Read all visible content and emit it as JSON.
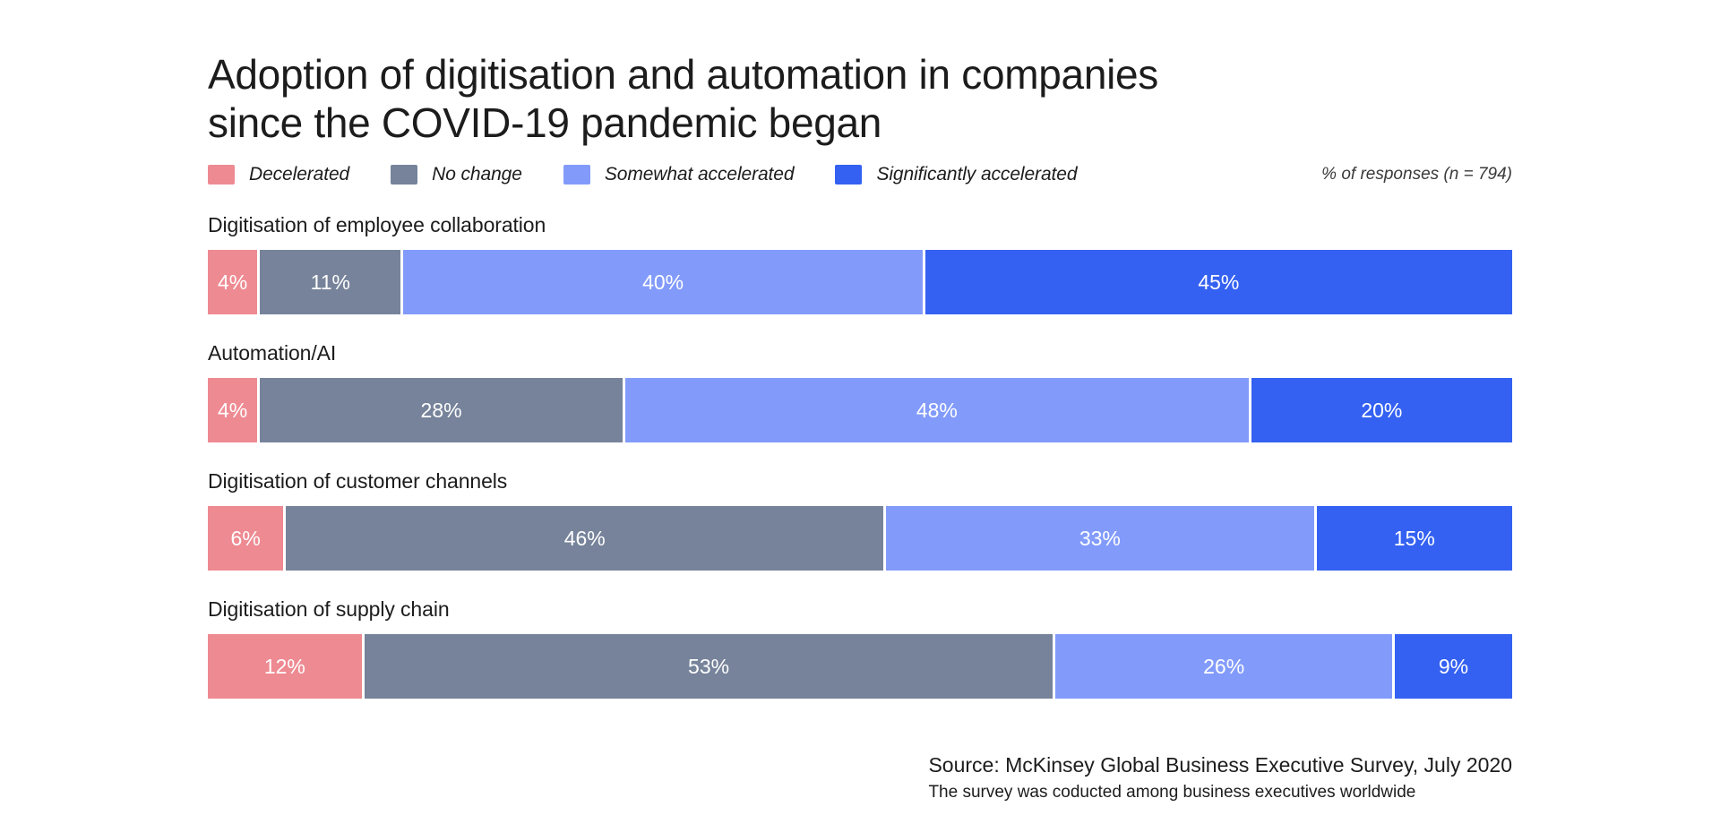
{
  "title": "Adoption of digitisation and automation in companies\nsince the COVID-19 pandemic began",
  "legend": {
    "note": "% of responses (n = 794)",
    "items": [
      {
        "label": "Decelerated",
        "color": "#ee8a92"
      },
      {
        "label": "No change",
        "color": "#76839a"
      },
      {
        "label": "Somewhat accelerated",
        "color": "#829bfb"
      },
      {
        "label": "Significantly accelerated",
        "color": "#3461f2"
      }
    ]
  },
  "footer": {
    "source": "Source: McKinsey Global Business Executive Survey, July 2020",
    "note": "The survey was coducted among business executives worldwide"
  },
  "chart_data": {
    "type": "bar",
    "subtype": "stacked-horizontal-100",
    "title": "Adoption of digitisation and automation in companies since the COVID-19 pandemic began",
    "xlabel": "",
    "ylabel": "",
    "xlim": [
      0,
      100
    ],
    "grid": false,
    "legend_position": "top-left",
    "value_suffix": "%",
    "categories": [
      "Digitisation of employee collaboration",
      "Automation/AI",
      "Digitisation of customer channels",
      "Digitisation of supply chain"
    ],
    "series": [
      {
        "name": "Decelerated",
        "color": "#ee8a92",
        "values": [
          4,
          4,
          6,
          12
        ]
      },
      {
        "name": "No change",
        "color": "#76839a",
        "values": [
          11,
          28,
          46,
          53
        ]
      },
      {
        "name": "Somewhat accelerated",
        "color": "#829bfb",
        "values": [
          40,
          48,
          33,
          26
        ]
      },
      {
        "name": "Significantly accelerated",
        "color": "#3461f2",
        "values": [
          45,
          20,
          15,
          9
        ]
      }
    ],
    "bars": [
      {
        "label": "Digitisation of employee collaboration",
        "segments": [
          {
            "name": "Decelerated",
            "value": 4,
            "text": "4%",
            "color": "#ee8a92"
          },
          {
            "name": "No change",
            "value": 11,
            "text": "11%",
            "color": "#76839a"
          },
          {
            "name": "Somewhat accelerated",
            "value": 40,
            "text": "40%",
            "color": "#829bfb"
          },
          {
            "name": "Significantly accelerated",
            "value": 45,
            "text": "45%",
            "color": "#3461f2"
          }
        ]
      },
      {
        "label": "Automation/AI",
        "segments": [
          {
            "name": "Decelerated",
            "value": 4,
            "text": "4%",
            "color": "#ee8a92"
          },
          {
            "name": "No change",
            "value": 28,
            "text": "28%",
            "color": "#76839a"
          },
          {
            "name": "Somewhat accelerated",
            "value": 48,
            "text": "48%",
            "color": "#829bfb"
          },
          {
            "name": "Significantly accelerated",
            "value": 20,
            "text": "20%",
            "color": "#3461f2"
          }
        ]
      },
      {
        "label": "Digitisation of customer channels",
        "segments": [
          {
            "name": "Decelerated",
            "value": 6,
            "text": "6%",
            "color": "#ee8a92"
          },
          {
            "name": "No change",
            "value": 46,
            "text": "46%",
            "color": "#76839a"
          },
          {
            "name": "Somewhat accelerated",
            "value": 33,
            "text": "33%",
            "color": "#829bfb"
          },
          {
            "name": "Significantly accelerated",
            "value": 15,
            "text": "15%",
            "color": "#3461f2"
          }
        ]
      },
      {
        "label": "Digitisation of supply chain",
        "segments": [
          {
            "name": "Decelerated",
            "value": 12,
            "text": "12%",
            "color": "#ee8a92"
          },
          {
            "name": "No change",
            "value": 53,
            "text": "53%",
            "color": "#76839a"
          },
          {
            "name": "Somewhat accelerated",
            "value": 26,
            "text": "26%",
            "color": "#829bfb"
          },
          {
            "name": "Significantly accelerated",
            "value": 9,
            "text": "9%",
            "color": "#3461f2"
          }
        ]
      }
    ]
  }
}
